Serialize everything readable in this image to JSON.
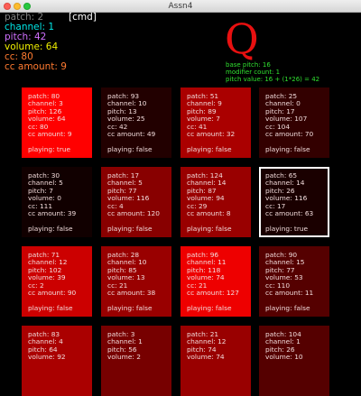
{
  "window": {
    "title": "Assn4"
  },
  "status": {
    "patch": "patch: 2",
    "channel": "channel: 1",
    "pitch": "pitch: 42",
    "volume": "volume: 64",
    "cc": "cc: 80",
    "cc_amount": "cc amount: 9",
    "cmd": "[cmd]"
  },
  "pitch_display": {
    "letter": "Q",
    "base_pitch": "base pitch: 16",
    "modifier_count": "modifier count: 1",
    "pitch_value": "pitch value: 16 + (1*26) = 42"
  },
  "pads": [
    {
      "patch": "80",
      "channel": "3",
      "pitch": "126",
      "volume": "64",
      "cc": "80",
      "cc_amount": "9",
      "playing": "true",
      "color": "#ff0000",
      "selected": false
    },
    {
      "patch": "93",
      "channel": "10",
      "pitch": "13",
      "volume": "25",
      "cc": "42",
      "cc_amount": "49",
      "playing": "false",
      "color": "#220000",
      "selected": false
    },
    {
      "patch": "51",
      "channel": "9",
      "pitch": "89",
      "volume": "7",
      "cc": "41",
      "cc_amount": "32",
      "playing": "false",
      "color": "#aa0000",
      "selected": false
    },
    {
      "patch": "25",
      "channel": "0",
      "pitch": "17",
      "volume": "107",
      "cc": "104",
      "cc_amount": "70",
      "playing": "false",
      "color": "#330000",
      "selected": false
    },
    {
      "patch": "30",
      "channel": "5",
      "pitch": "7",
      "volume": "0",
      "cc": "111",
      "cc_amount": "39",
      "playing": "false",
      "color": "#110000",
      "selected": false
    },
    {
      "patch": "17",
      "channel": "5",
      "pitch": "77",
      "volume": "116",
      "cc": "4",
      "cc_amount": "120",
      "playing": "false",
      "color": "#880000",
      "selected": false
    },
    {
      "patch": "124",
      "channel": "14",
      "pitch": "87",
      "volume": "94",
      "cc": "29",
      "cc_amount": "8",
      "playing": "false",
      "color": "#990000",
      "selected": false
    },
    {
      "patch": "65",
      "channel": "14",
      "pitch": "26",
      "volume": "116",
      "cc": "17",
      "cc_amount": "63",
      "playing": "true",
      "color": "#1a0000",
      "selected": true
    },
    {
      "patch": "71",
      "channel": "12",
      "pitch": "102",
      "volume": "39",
      "cc": "2",
      "cc_amount": "90",
      "playing": "false",
      "color": "#cc0000",
      "selected": false
    },
    {
      "patch": "28",
      "channel": "10",
      "pitch": "85",
      "volume": "13",
      "cc": "21",
      "cc_amount": "38",
      "playing": "false",
      "color": "#990000",
      "selected": false
    },
    {
      "patch": "96",
      "channel": "11",
      "pitch": "118",
      "volume": "74",
      "cc": "21",
      "cc_amount": "127",
      "playing": "false",
      "color": "#ee0000",
      "selected": false
    },
    {
      "patch": "90",
      "channel": "15",
      "pitch": "77",
      "volume": "53",
      "cc": "110",
      "cc_amount": "11",
      "playing": "false",
      "color": "#550000",
      "selected": false
    },
    {
      "patch": "83",
      "channel": "4",
      "pitch": "64",
      "volume": "92",
      "cc": "",
      "cc_amount": "",
      "playing": "",
      "color": "#aa0000",
      "selected": false
    },
    {
      "patch": "3",
      "channel": "1",
      "pitch": "56",
      "volume": "2",
      "cc": "",
      "cc_amount": "",
      "playing": "",
      "color": "#770000",
      "selected": false
    },
    {
      "patch": "21",
      "channel": "12",
      "pitch": "74",
      "volume": "74",
      "cc": "",
      "cc_amount": "",
      "playing": "",
      "color": "#990000",
      "selected": false
    },
    {
      "patch": "104",
      "channel": "1",
      "pitch": "26",
      "volume": "10",
      "cc": "",
      "cc_amount": "",
      "playing": "",
      "color": "#550000",
      "selected": false
    }
  ]
}
